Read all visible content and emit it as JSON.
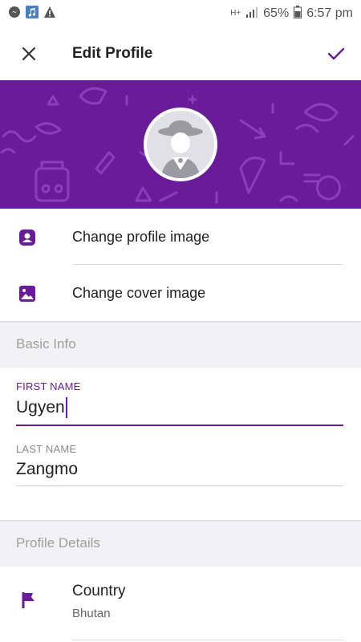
{
  "status_bar": {
    "left_icons": [
      "messenger-icon",
      "music-icon",
      "alert-icon"
    ],
    "network": "H+",
    "battery": "65%",
    "time": "6:57 pm"
  },
  "app_bar": {
    "title": "Edit Profile",
    "close_icon": "close-icon",
    "save_icon": "check-icon"
  },
  "colors": {
    "accent": "#6a1b9a",
    "background": "#f2f2f4"
  },
  "image_actions": [
    {
      "label": "Change profile image",
      "icon": "portrait-icon"
    },
    {
      "label": "Change cover image",
      "icon": "image-icon"
    }
  ],
  "basic_info": {
    "header": "Basic Info",
    "first_name": {
      "label": "FIRST NAME",
      "value": "Ugyen"
    },
    "last_name": {
      "label": "LAST NAME",
      "value": "Zangmo"
    }
  },
  "profile_details": {
    "header": "Profile Details",
    "country": {
      "label": "Country",
      "value": "Bhutan",
      "icon": "flag-icon"
    }
  }
}
